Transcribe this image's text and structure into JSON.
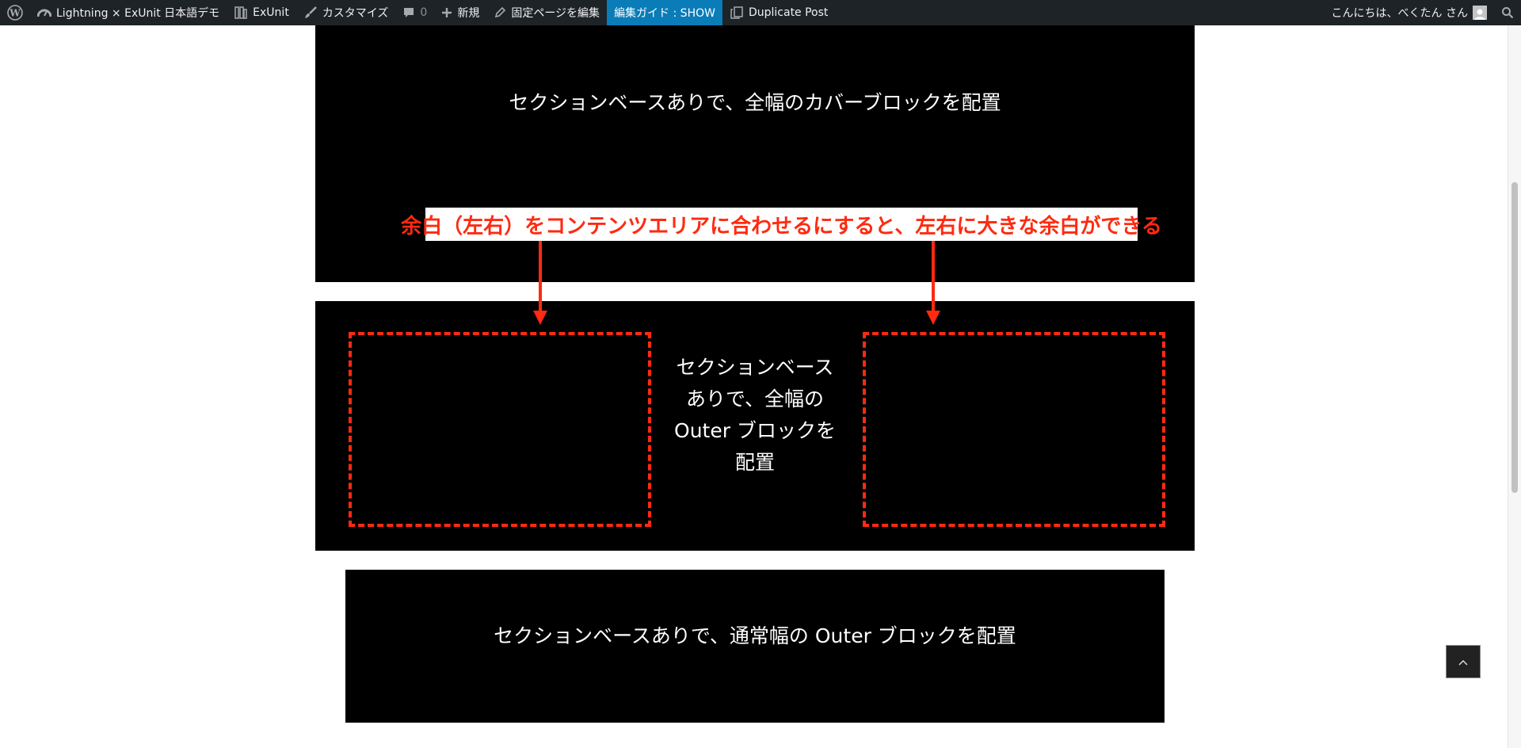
{
  "adminbar": {
    "wp_logo": "wordpress-logo",
    "site_name": "Lightning × ExUnit 日本語デモ",
    "exunit": "ExUnit",
    "customize": "カスタマイズ",
    "comments_count": "0",
    "new_label": "新規",
    "edit_page": "固定ページを編集",
    "guide": "編集ガイド : SHOW",
    "duplicate": "Duplicate Post",
    "greeting": "こんにちは、べくたん さん"
  },
  "sections": {
    "cover_heading": "セクションベースありで、全幅のカバーブロックを配置",
    "outer_full_lines": [
      "セクションベース",
      "ありで、全幅の",
      "Outer ブロックを",
      "配置"
    ],
    "outer_normal_heading": "セクションベースありで、通常幅の Outer ブロックを配置"
  },
  "annotation": {
    "callout": "余白（左右）をコンテンツエリアに合わせるにすると、左右に大きな余白ができる",
    "color": "#ff2a10"
  },
  "colors": {
    "adminbar_bg": "#1d2327",
    "highlight": "#0a7cb8",
    "block_bg": "#000000"
  }
}
